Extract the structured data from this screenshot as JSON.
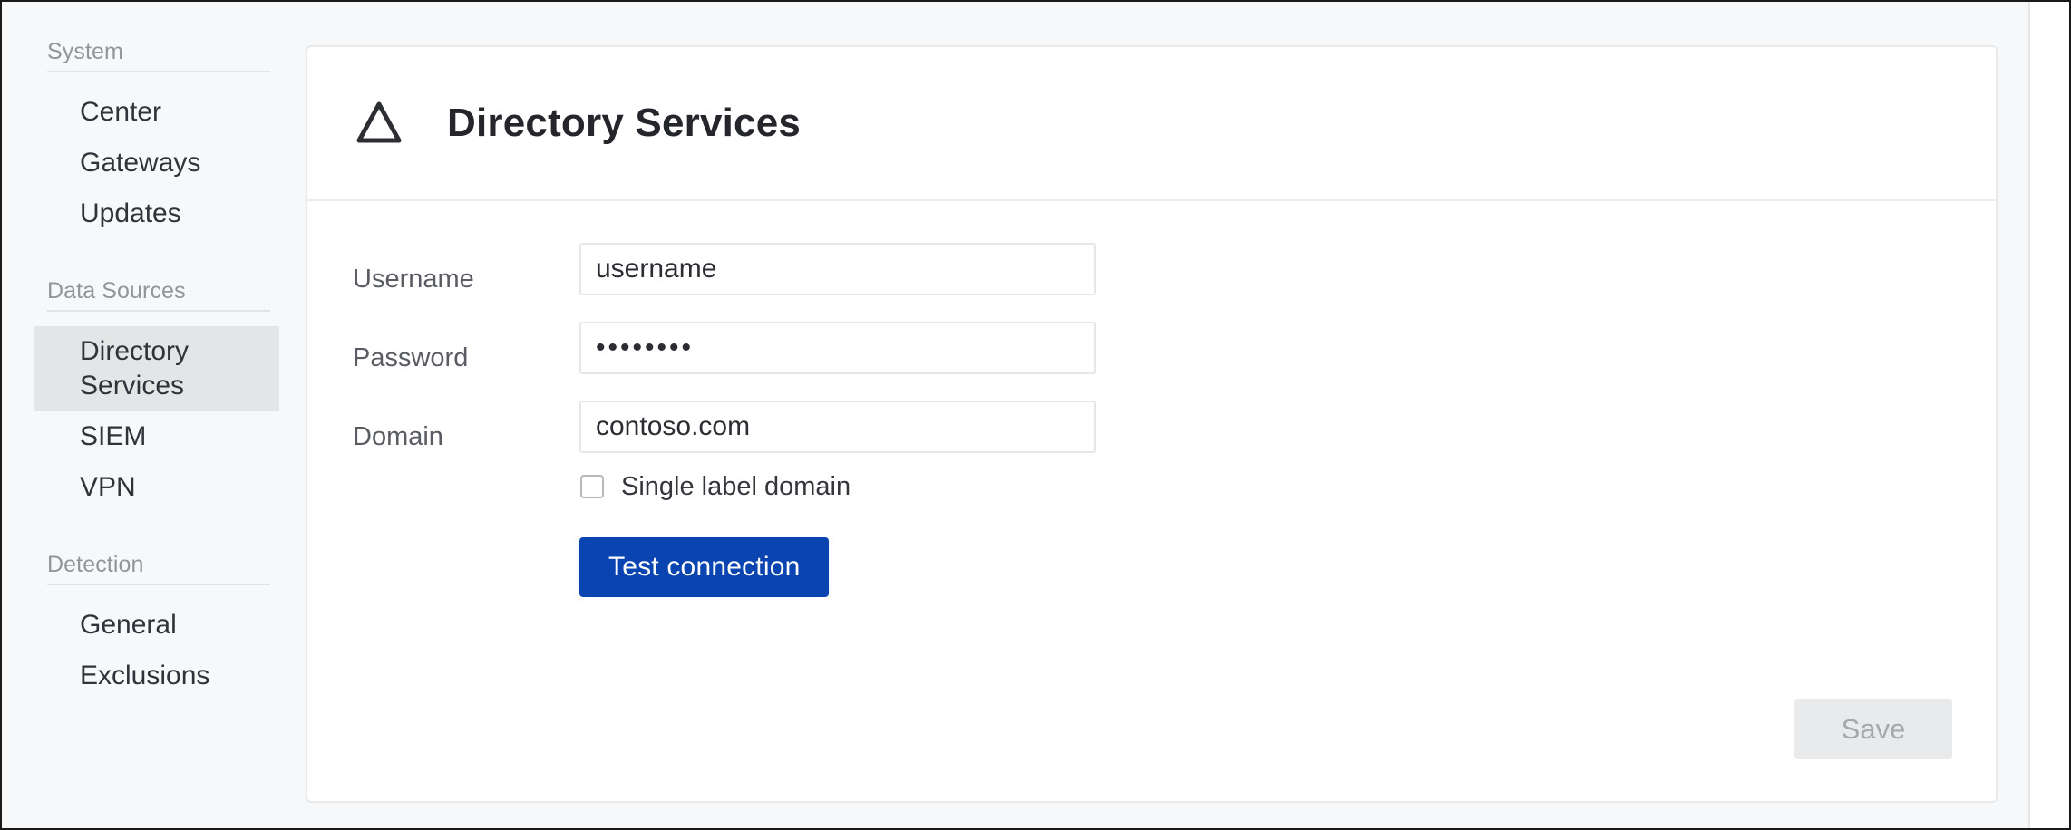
{
  "sidebar": {
    "groups": [
      {
        "title": "System",
        "items": [
          {
            "label": "Center",
            "selected": false
          },
          {
            "label": "Gateways",
            "selected": false
          },
          {
            "label": "Updates",
            "selected": false
          }
        ]
      },
      {
        "title": "Data Sources",
        "items": [
          {
            "label": "Directory\nServices",
            "selected": true
          },
          {
            "label": "SIEM",
            "selected": false
          },
          {
            "label": "VPN",
            "selected": false
          }
        ]
      },
      {
        "title": "Detection",
        "items": [
          {
            "label": "General",
            "selected": false
          },
          {
            "label": "Exclusions",
            "selected": false
          }
        ]
      }
    ]
  },
  "panel": {
    "icon": "triangle-outline-icon",
    "title": "Directory Services"
  },
  "form": {
    "username": {
      "label": "Username",
      "value": "username",
      "placeholder": "username"
    },
    "password": {
      "label": "Password",
      "value": "••••••••",
      "masked_char_count": 8
    },
    "domain": {
      "label": "Domain",
      "value": "contoso.com",
      "placeholder": "contoso.com"
    },
    "single_label_domain": {
      "label": "Single label domain",
      "checked": false
    },
    "test_connection_label": "Test connection",
    "save_label": "Save",
    "save_enabled": false
  },
  "colors": {
    "primary_button": "#0a44b0",
    "sidebar_background": "#f7f8fa",
    "selected_item_background": "#e4e5e7",
    "disabled_button_background": "#e9eaec"
  }
}
